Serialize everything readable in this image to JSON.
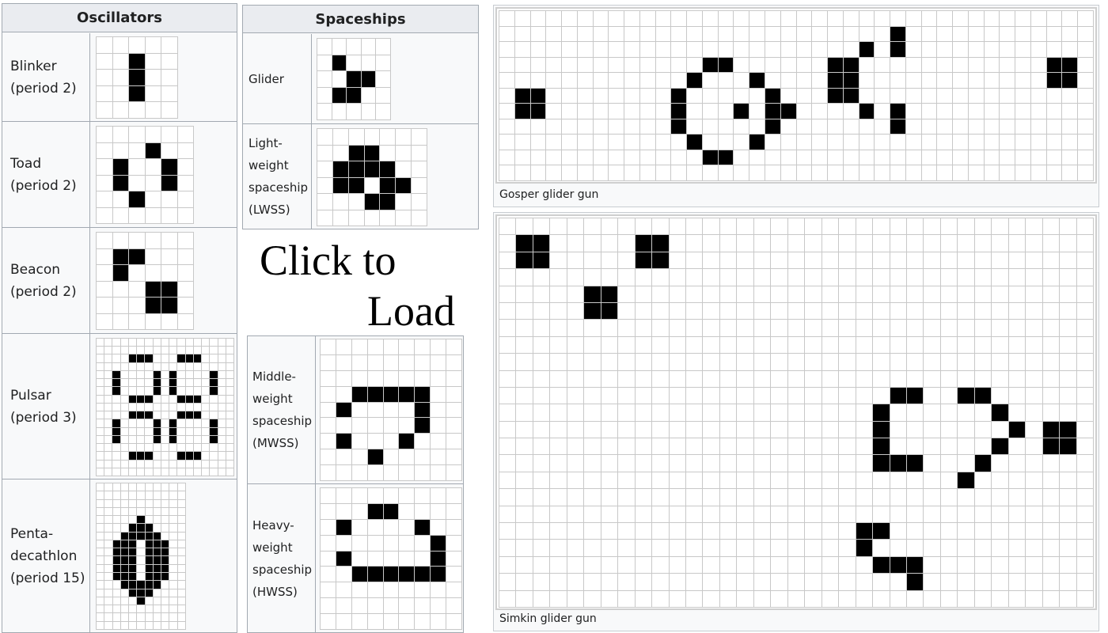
{
  "oscillators": {
    "header": "Oscillators",
    "rows": [
      {
        "name": "Blinker",
        "period": "(period 2)"
      },
      {
        "name": "Toad",
        "period": "(period 2)"
      },
      {
        "name": "Beacon",
        "period": "(period 2)"
      },
      {
        "name": "Pulsar",
        "period": "(period 3)"
      },
      {
        "name": "Penta-",
        "name2": "decathlon",
        "period": "(period 15)"
      }
    ]
  },
  "spaceships": {
    "header": "Spaceships",
    "rows": [
      {
        "lines": [
          "Glider"
        ]
      },
      {
        "lines": [
          "Light-",
          "weight",
          "spaceship",
          "(LWSS)"
        ]
      },
      {
        "lines": [
          "Middle-",
          "weight",
          "spaceship",
          "(MWSS)"
        ]
      },
      {
        "lines": [
          "Heavy-",
          "weight",
          "spaceship",
          "(HWSS)"
        ]
      }
    ]
  },
  "cta": {
    "line1": "Click to",
    "line2": "Load"
  },
  "guns": {
    "gosper_caption": "Gosper glider gun",
    "simkin_caption": "Simkin glider gun"
  },
  "colors": {
    "live_cell": "#000000",
    "dead_cell": "#ffffff",
    "grid_line": "#c8c8c8",
    "table_header": "#eaecf0",
    "table_bg": "#f8f9fa"
  },
  "patterns": {
    "blinker": {
      "cols": 5,
      "rows": 5,
      "cells": [
        [
          1,
          2
        ],
        [
          2,
          2
        ],
        [
          3,
          2
        ]
      ]
    },
    "toad": {
      "cols": 6,
      "rows": 6,
      "cells": [
        [
          1,
          3
        ],
        [
          2,
          1
        ],
        [
          2,
          4
        ],
        [
          3,
          1
        ],
        [
          3,
          4
        ],
        [
          4,
          2
        ]
      ]
    },
    "beacon": {
      "cols": 6,
      "rows": 6,
      "cells": [
        [
          1,
          1
        ],
        [
          1,
          2
        ],
        [
          2,
          1
        ],
        [
          3,
          3
        ],
        [
          3,
          4
        ],
        [
          4,
          3
        ],
        [
          4,
          4
        ]
      ]
    },
    "pulsar": {
      "cols": 17,
      "rows": 17,
      "cells": [
        [
          2,
          4
        ],
        [
          2,
          5
        ],
        [
          2,
          6
        ],
        [
          2,
          10
        ],
        [
          2,
          11
        ],
        [
          2,
          12
        ],
        [
          4,
          2
        ],
        [
          4,
          7
        ],
        [
          4,
          9
        ],
        [
          4,
          14
        ],
        [
          5,
          2
        ],
        [
          5,
          7
        ],
        [
          5,
          9
        ],
        [
          5,
          14
        ],
        [
          6,
          2
        ],
        [
          6,
          7
        ],
        [
          6,
          9
        ],
        [
          6,
          14
        ],
        [
          7,
          4
        ],
        [
          7,
          5
        ],
        [
          7,
          6
        ],
        [
          7,
          10
        ],
        [
          7,
          11
        ],
        [
          7,
          12
        ],
        [
          9,
          4
        ],
        [
          9,
          5
        ],
        [
          9,
          6
        ],
        [
          9,
          10
        ],
        [
          9,
          11
        ],
        [
          9,
          12
        ],
        [
          10,
          2
        ],
        [
          10,
          7
        ],
        [
          10,
          9
        ],
        [
          10,
          14
        ],
        [
          11,
          2
        ],
        [
          11,
          7
        ],
        [
          11,
          9
        ],
        [
          11,
          14
        ],
        [
          12,
          2
        ],
        [
          12,
          7
        ],
        [
          12,
          9
        ],
        [
          12,
          14
        ],
        [
          14,
          4
        ],
        [
          14,
          5
        ],
        [
          14,
          6
        ],
        [
          14,
          10
        ],
        [
          14,
          11
        ],
        [
          14,
          12
        ]
      ]
    },
    "pentadecathlon": {
      "cols": 11,
      "rows": 18,
      "cells": [
        [
          4,
          5
        ],
        [
          5,
          4
        ],
        [
          5,
          5
        ],
        [
          5,
          6
        ],
        [
          6,
          3
        ],
        [
          6,
          4
        ],
        [
          6,
          5
        ],
        [
          6,
          6
        ],
        [
          6,
          7
        ],
        [
          7,
          2
        ],
        [
          7,
          3
        ],
        [
          7,
          4
        ],
        [
          7,
          6
        ],
        [
          7,
          7
        ],
        [
          7,
          8
        ],
        [
          8,
          2
        ],
        [
          8,
          3
        ],
        [
          8,
          4
        ],
        [
          8,
          6
        ],
        [
          8,
          7
        ],
        [
          8,
          8
        ],
        [
          9,
          2
        ],
        [
          9,
          3
        ],
        [
          9,
          4
        ],
        [
          9,
          6
        ],
        [
          9,
          7
        ],
        [
          9,
          8
        ],
        [
          10,
          2
        ],
        [
          10,
          3
        ],
        [
          10,
          4
        ],
        [
          10,
          6
        ],
        [
          10,
          7
        ],
        [
          10,
          8
        ],
        [
          11,
          2
        ],
        [
          11,
          3
        ],
        [
          11,
          4
        ],
        [
          11,
          6
        ],
        [
          11,
          7
        ],
        [
          11,
          8
        ],
        [
          12,
          3
        ],
        [
          12,
          4
        ],
        [
          12,
          5
        ],
        [
          12,
          6
        ],
        [
          12,
          7
        ],
        [
          13,
          4
        ],
        [
          13,
          5
        ],
        [
          13,
          6
        ],
        [
          14,
          5
        ]
      ]
    },
    "glider": {
      "cols": 5,
      "rows": 5,
      "cells": [
        [
          1,
          1
        ],
        [
          2,
          2
        ],
        [
          2,
          3
        ],
        [
          3,
          1
        ],
        [
          3,
          2
        ]
      ]
    },
    "lwss": {
      "cols": 7,
      "rows": 6,
      "cells": [
        [
          1,
          2
        ],
        [
          1,
          3
        ],
        [
          2,
          1
        ],
        [
          2,
          2
        ],
        [
          2,
          3
        ],
        [
          2,
          4
        ],
        [
          3,
          1
        ],
        [
          3,
          2
        ],
        [
          3,
          4
        ],
        [
          3,
          5
        ],
        [
          4,
          3
        ],
        [
          4,
          4
        ]
      ]
    },
    "mwss": {
      "cols": 9,
      "rows": 9,
      "cells": [
        [
          3,
          2
        ],
        [
          3,
          3
        ],
        [
          3,
          4
        ],
        [
          3,
          5
        ],
        [
          3,
          6
        ],
        [
          4,
          1
        ],
        [
          4,
          6
        ],
        [
          5,
          6
        ],
        [
          6,
          1
        ],
        [
          6,
          5
        ],
        [
          7,
          3
        ]
      ]
    },
    "hwss": {
      "cols": 9,
      "rows": 9,
      "cells": [
        [
          1,
          3
        ],
        [
          1,
          4
        ],
        [
          2,
          1
        ],
        [
          2,
          6
        ],
        [
          3,
          7
        ],
        [
          4,
          1
        ],
        [
          4,
          7
        ],
        [
          5,
          2
        ],
        [
          5,
          3
        ],
        [
          5,
          4
        ],
        [
          5,
          5
        ],
        [
          5,
          6
        ],
        [
          5,
          7
        ]
      ]
    },
    "gosper": {
      "cols": 38,
      "rows": 11,
      "cells": [
        [
          5,
          1
        ],
        [
          5,
          2
        ],
        [
          6,
          1
        ],
        [
          6,
          2
        ],
        [
          3,
          13
        ],
        [
          3,
          14
        ],
        [
          4,
          12
        ],
        [
          4,
          16
        ],
        [
          5,
          11
        ],
        [
          5,
          17
        ],
        [
          6,
          11
        ],
        [
          6,
          15
        ],
        [
          6,
          17
        ],
        [
          6,
          18
        ],
        [
          7,
          11
        ],
        [
          7,
          17
        ],
        [
          8,
          12
        ],
        [
          8,
          16
        ],
        [
          9,
          13
        ],
        [
          9,
          14
        ],
        [
          1,
          25
        ],
        [
          2,
          23
        ],
        [
          2,
          25
        ],
        [
          3,
          21
        ],
        [
          3,
          22
        ],
        [
          4,
          21
        ],
        [
          4,
          22
        ],
        [
          5,
          21
        ],
        [
          5,
          22
        ],
        [
          6,
          23
        ],
        [
          6,
          25
        ],
        [
          7,
          25
        ],
        [
          3,
          35
        ],
        [
          3,
          36
        ],
        [
          4,
          35
        ],
        [
          4,
          36
        ]
      ]
    },
    "simkin": {
      "cols": 35,
      "rows": 23,
      "cells": [
        [
          1,
          1
        ],
        [
          1,
          2
        ],
        [
          2,
          1
        ],
        [
          2,
          2
        ],
        [
          1,
          8
        ],
        [
          1,
          9
        ],
        [
          2,
          8
        ],
        [
          2,
          9
        ],
        [
          4,
          5
        ],
        [
          4,
          6
        ],
        [
          5,
          5
        ],
        [
          5,
          6
        ],
        [
          10,
          23
        ],
        [
          10,
          24
        ],
        [
          10,
          27
        ],
        [
          10,
          28
        ],
        [
          11,
          22
        ],
        [
          11,
          29
        ],
        [
          12,
          22
        ],
        [
          12,
          30
        ],
        [
          13,
          22
        ],
        [
          13,
          29
        ],
        [
          14,
          22
        ],
        [
          14,
          23
        ],
        [
          14,
          24
        ],
        [
          14,
          28
        ],
        [
          15,
          27
        ],
        [
          12,
          32
        ],
        [
          12,
          33
        ],
        [
          13,
          32
        ],
        [
          13,
          33
        ],
        [
          18,
          21
        ],
        [
          18,
          22
        ],
        [
          19,
          21
        ],
        [
          20,
          22
        ],
        [
          20,
          23
        ],
        [
          20,
          24
        ],
        [
          21,
          24
        ]
      ]
    }
  }
}
